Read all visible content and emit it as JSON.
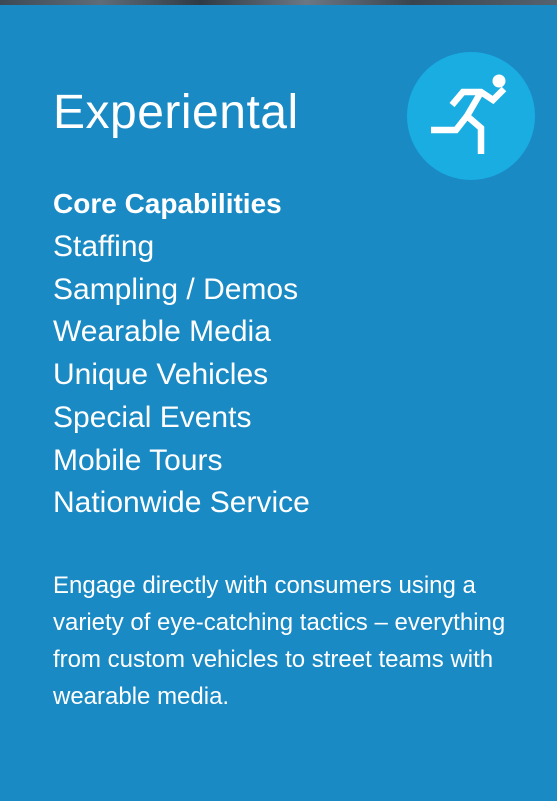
{
  "card": {
    "title": "Experiental",
    "icon": "running-person-icon",
    "colors": {
      "background": "#1a8ac4",
      "icon_circle": "#19ade2",
      "text": "#ffffff"
    }
  },
  "capabilities": {
    "heading": "Core Capabilities",
    "items": [
      "Staffing",
      "Sampling / Demos",
      "Wearable Media",
      "Unique Vehicles",
      "Special Events",
      "Mobile Tours",
      "Nationwide Service"
    ]
  },
  "description": "Engage directly with consumers using a variety of eye-catching tactics – everything from custom vehicles to street teams with wearable  media."
}
